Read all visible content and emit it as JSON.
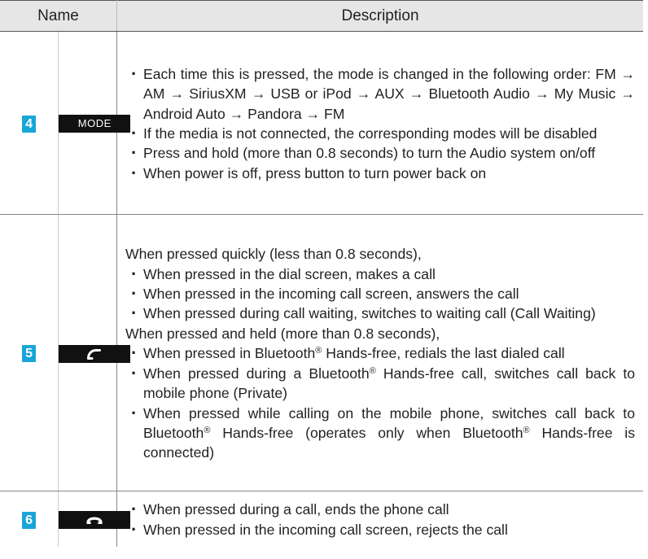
{
  "header": {
    "name": "Name",
    "description": "Description"
  },
  "rows": [
    {
      "num": "4",
      "button": "MODE",
      "button_icon": "mode-button",
      "items": [
        "Each time this is pressed, the mode is changed in the following order: FM → AM → SiriusXM → USB or iPod → AUX → Bluetooth Audio → My Music → Android Auto → Pandora → FM",
        "If the media is not connected, the corresponding modes will be disabled",
        "Press and hold (more than 0.8 seconds) to turn the Audio system on/off",
        "When power is off, press button to turn power back on"
      ]
    },
    {
      "num": "5",
      "button_icon": "call-answer-icon",
      "intro_quick": "When pressed quickly (less than 0.8 seconds),",
      "quick_items": [
        "When pressed in the dial screen, makes a call",
        "When pressed in the incoming call screen, answers the call",
        "When pressed during call waiting, switches to waiting call (Call Waiting)"
      ],
      "intro_held": "When pressed and held (more than 0.8 seconds),",
      "held_1_a": "When pressed in Bluetooth",
      "held_1_b": " Hands-free, redials the last dialed call",
      "held_2_a": "When pressed during a Bluetooth",
      "held_2_b": " Hands-free call, switches call back to mobile phone (Private)",
      "held_3_a": "When pressed while calling on the mobile phone, switches call back to Bluetooth",
      "held_3_b": " Hands-free (operates only when Bluetooth",
      "held_3_c": " Hands-free is connected)",
      "reg": "®"
    },
    {
      "num": "6",
      "button_icon": "call-end-icon",
      "items": [
        "When pressed during a call, ends the phone call",
        "When pressed in the incoming call screen, rejects the call"
      ]
    }
  ],
  "colors": {
    "badge": "#19a5d8",
    "button": "#111111",
    "header_bg": "#e6e6e6"
  }
}
